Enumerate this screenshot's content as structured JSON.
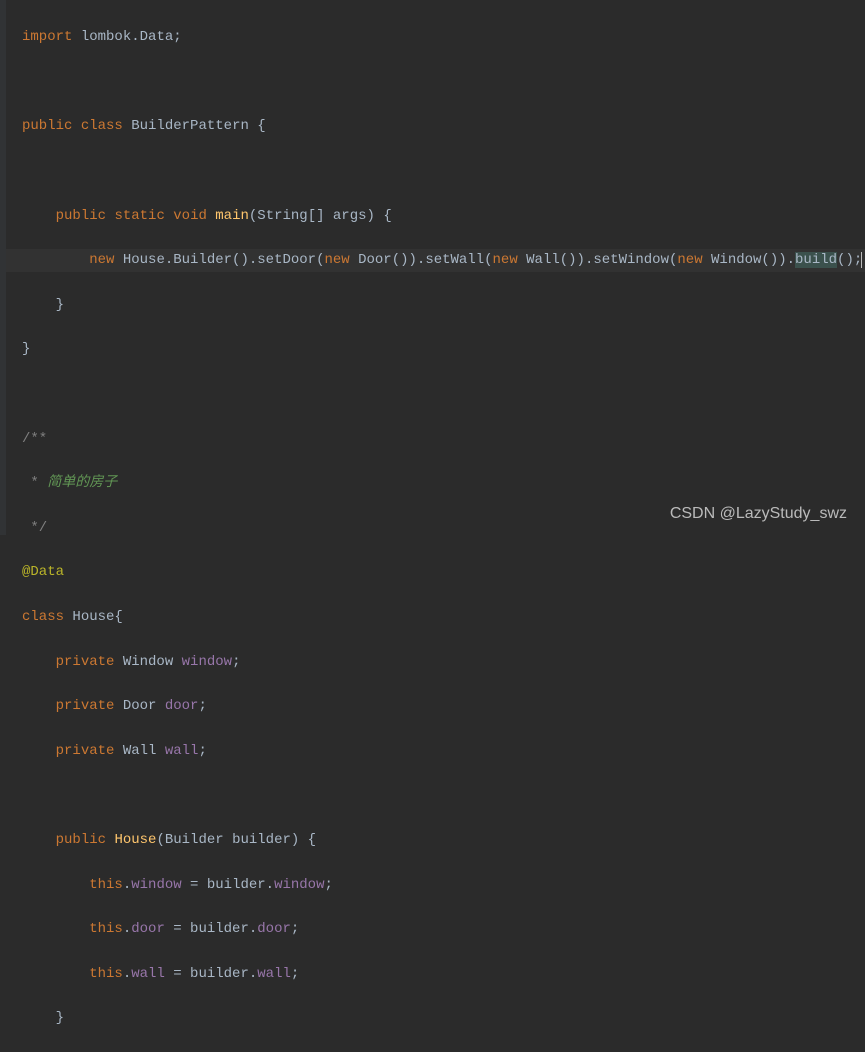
{
  "code": {
    "l1_import": "import",
    "l1_pkg": " lombok.",
    "l1_data": "Data",
    "l1_semi": ";",
    "l3_public": "public",
    "l3_class": "class",
    "l3_name": "BuilderPattern",
    "l3_brace": " {",
    "l5_public": "public",
    "l5_static": "static",
    "l5_void": "void",
    "l5_main": "main",
    "l5_sig": "(String[] args) {",
    "l6_new1": "new",
    "l6_house": " House.Builder().setDoor(",
    "l6_new2": "new",
    "l6_door": " Door()).setWall(",
    "l6_new3": "new",
    "l6_wall": " Wall()).setWindow(",
    "l6_new4": "new",
    "l6_window": " Window()).",
    "l6_build": "build",
    "l6_end": "();",
    "l7_brace": "    }",
    "l8_brace": "}",
    "l10_comment_start": "/**",
    "l11_comment_star": " * ",
    "l11_comment_text": "简单的房子",
    "l12_comment_end": " */",
    "l13_annotation": "@Data",
    "l14_class": "class",
    "l14_name": " House{",
    "l15_private": "private",
    "l15_type": " Window ",
    "l15_field": "window",
    "l15_semi": ";",
    "l16_private": "private",
    "l16_type": " Door ",
    "l16_field": "door",
    "l16_semi": ";",
    "l17_private": "private",
    "l17_type": " Wall ",
    "l17_field": "wall",
    "l17_semi": ";",
    "l19_public": "public",
    "l19_name": "House",
    "l19_sig": "(Builder builder) {",
    "l20_this": "this",
    "l20_dot": ".",
    "l20_field1": "window",
    "l20_eq": " = builder.",
    "l20_field2": "window",
    "l20_semi": ";",
    "l21_this": "this",
    "l21_dot": ".",
    "l21_field1": "door",
    "l21_eq": " = builder.",
    "l21_field2": "door",
    "l21_semi": ";",
    "l22_this": "this",
    "l22_dot": ".",
    "l22_field1": "wall",
    "l22_eq": " = builder.",
    "l22_field2": "wall",
    "l22_semi": ";",
    "l23_brace": "    }"
  },
  "watermark": "CSDN @LazyStudy_swz"
}
